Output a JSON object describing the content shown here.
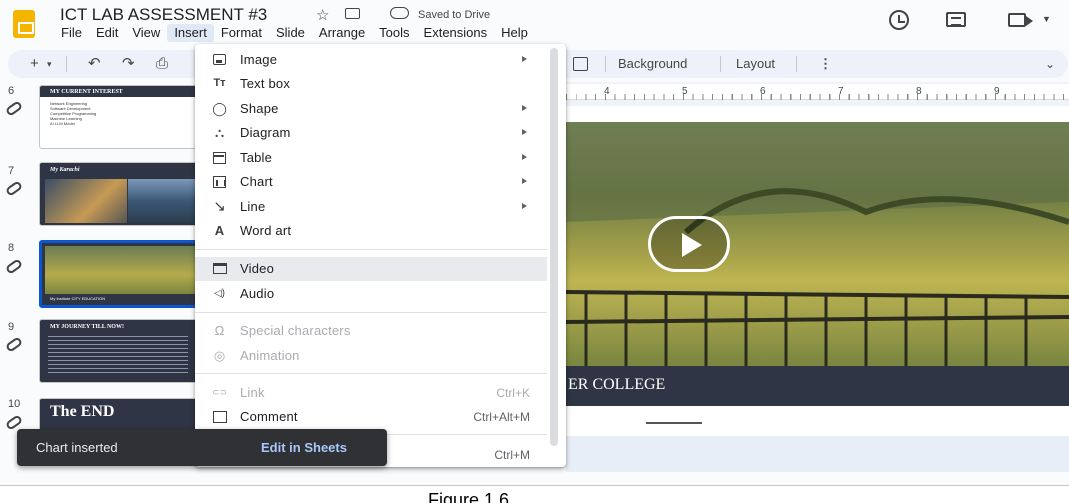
{
  "app": {
    "title": "ICT LAB ASSESSMENT #3",
    "save_status": "Saved to Drive"
  },
  "menubar": [
    "File",
    "Edit",
    "View",
    "Insert",
    "Format",
    "Slide",
    "Arrange",
    "Tools",
    "Extensions",
    "Help"
  ],
  "menubar_active": "Insert",
  "toolbar": {
    "background_label": "Background",
    "layout_label": "Layout",
    "more_label": "⋮"
  },
  "filmstrip": {
    "slides": [
      {
        "number": "6",
        "title": "MY CURRENT INTEREST",
        "lines": [
          "Network Engineering",
          "Software Development",
          "Competitive Programming",
          "Machine Learning",
          "AI LLM Model"
        ]
      },
      {
        "number": "7",
        "title": "My Karachi"
      },
      {
        "number": "8",
        "caption": "My Institute CITY EDUCATION",
        "selected": true
      },
      {
        "number": "9",
        "title": "MY JOURNEY TILL NOW!"
      },
      {
        "number": "10",
        "title": "The END"
      }
    ]
  },
  "ruler": [
    "4",
    "5",
    "6",
    "7",
    "8",
    "9"
  ],
  "slide": {
    "caption": "ER COLLEGE"
  },
  "insert_menu": {
    "items": [
      {
        "label": "Image",
        "icon": "image-icon",
        "submenu": true
      },
      {
        "label": "Text box",
        "icon": "text-box-icon",
        "glyph": "Tт"
      },
      {
        "label": "Shape",
        "icon": "shape-icon",
        "submenu": true
      },
      {
        "label": "Diagram",
        "icon": "diagram-icon",
        "submenu": true
      },
      {
        "label": "Table",
        "icon": "table-icon",
        "submenu": true
      },
      {
        "label": "Chart",
        "icon": "chart-icon",
        "submenu": true
      },
      {
        "label": "Line",
        "icon": "line-icon",
        "submenu": true
      },
      {
        "label": "Word art",
        "icon": "word-art-icon",
        "glyph": "A"
      },
      {
        "label": "Video",
        "icon": "video-icon",
        "hover": true
      },
      {
        "label": "Audio",
        "icon": "audio-icon",
        "glyph": "◁)"
      },
      {
        "label": "Special characters",
        "icon": "omega-icon",
        "glyph": "Ω",
        "disabled": true
      },
      {
        "label": "Animation",
        "icon": "animation-icon",
        "glyph": "◎",
        "disabled": true
      },
      {
        "label": "Link",
        "icon": "link-icon",
        "glyph": "⊂⊃",
        "disabled": true,
        "shortcut": "Ctrl+K"
      },
      {
        "label": "Comment",
        "icon": "comment-icon",
        "shortcut": "Ctrl+Alt+M"
      },
      {
        "label": "",
        "icon": "",
        "shortcut": "Ctrl+M"
      }
    ]
  },
  "snackbar": {
    "message": "Chart inserted",
    "action": "Edit in Sheets"
  },
  "figure_caption": "Figure 1.6"
}
